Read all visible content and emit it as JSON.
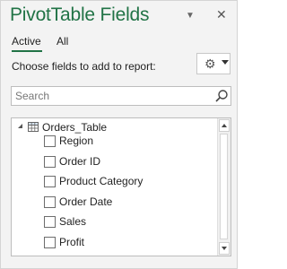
{
  "header": {
    "title": "PivotTable Fields",
    "collapse_icon": "chevron-down-icon",
    "close_icon": "close-icon",
    "close_glyph": "✕"
  },
  "tabs": [
    {
      "label": "Active",
      "selected": true
    },
    {
      "label": "All",
      "selected": false
    }
  ],
  "choose_label": "Choose fields to add to report:",
  "tools_button": {
    "icon": "gear-icon",
    "dropdown": "caret-down-icon"
  },
  "search": {
    "placeholder": "Search",
    "value": ""
  },
  "field_list": {
    "table_name": "Orders_Table",
    "expanded": true,
    "fields": [
      {
        "label": "Region",
        "checked": false
      },
      {
        "label": "Order ID",
        "checked": false
      },
      {
        "label": "Product Category",
        "checked": false
      },
      {
        "label": "Order Date",
        "checked": false
      },
      {
        "label": "Sales",
        "checked": false
      },
      {
        "label": "Profit",
        "checked": false
      }
    ]
  },
  "colors": {
    "accent": "#217346",
    "pane_background": "#f3f3f3",
    "border": "#bdbdbd"
  }
}
